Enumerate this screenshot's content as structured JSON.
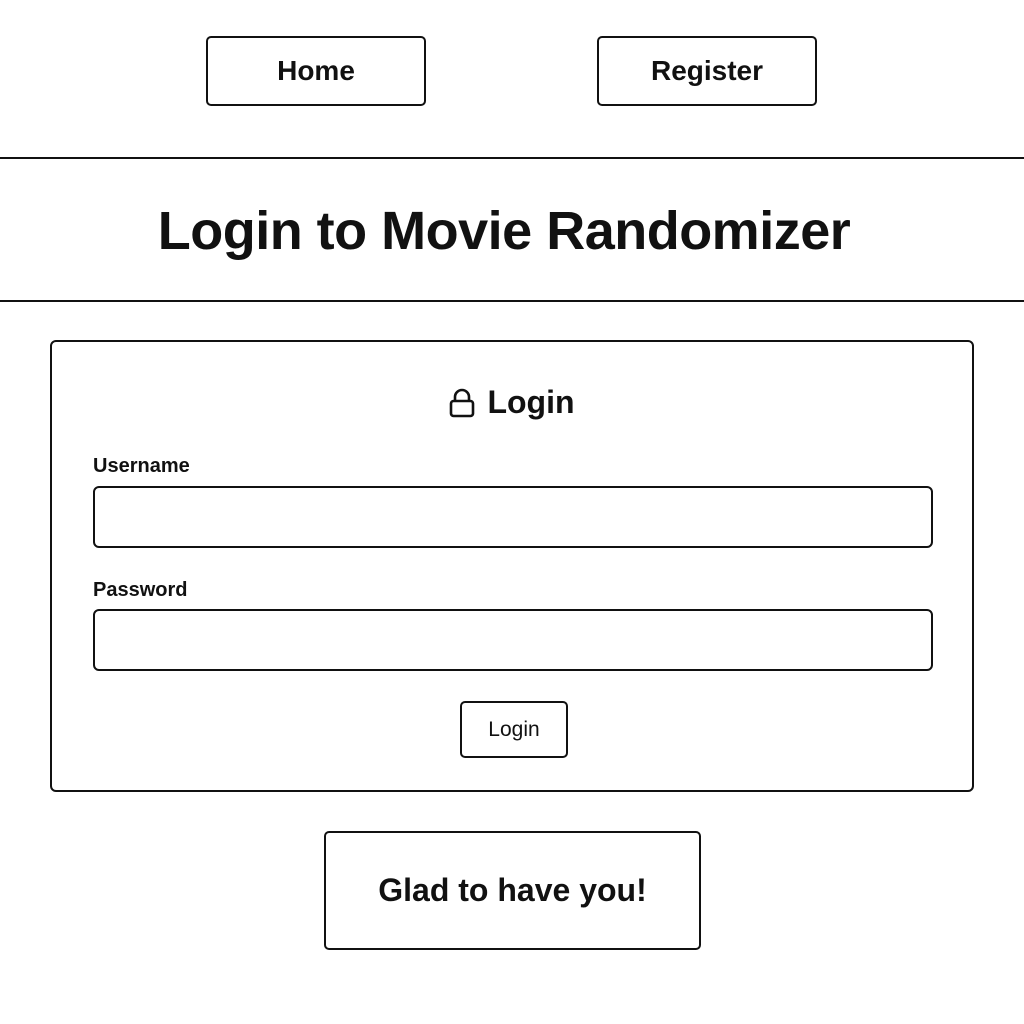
{
  "nav": {
    "home_label": "Home",
    "register_label": "Register"
  },
  "header": {
    "title": "Login to Movie Randomizer"
  },
  "login_form": {
    "heading": "Login",
    "heading_icon": "lock-icon",
    "username": {
      "label": "Username",
      "value": "",
      "placeholder": ""
    },
    "password": {
      "label": "Password",
      "value": "",
      "placeholder": ""
    },
    "submit_label": "Login"
  },
  "footer": {
    "message": "Glad to have you!"
  },
  "colors": {
    "background": "#ffffff",
    "border": "#111111",
    "text": "#111111"
  }
}
